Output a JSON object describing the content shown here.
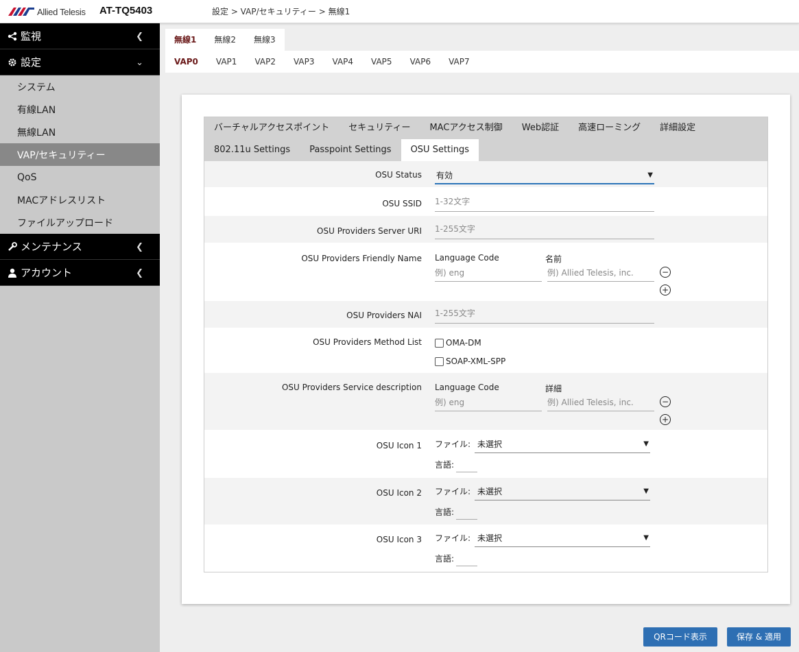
{
  "header": {
    "brand": "Allied Telesis",
    "model": "AT-TQ5403",
    "breadcrumb": "設定 > VAP/セキュリティー > 無線1"
  },
  "sidebar": {
    "sections": [
      {
        "label": "監視",
        "icon": "share-icon"
      },
      {
        "label": "設定",
        "icon": "gear-icon"
      },
      {
        "label": "メンテナンス",
        "icon": "wrench-icon"
      },
      {
        "label": "アカウント",
        "icon": "user-icon"
      }
    ],
    "settings_items": [
      "システム",
      "有線LAN",
      "無線LAN",
      "VAP/セキュリティー",
      "QoS",
      "MACアドレスリスト",
      "ファイルアップロード"
    ]
  },
  "radio_tabs": [
    "無線1",
    "無線2",
    "無線3"
  ],
  "vap_tabs": [
    "VAP0",
    "VAP1",
    "VAP2",
    "VAP3",
    "VAP4",
    "VAP5",
    "VAP6",
    "VAP7"
  ],
  "panel_tabs_row1": [
    "バーチャルアクセスポイント",
    "セキュリティー",
    "MACアクセス制御",
    "Web認証",
    "高速ローミング",
    "詳細設定"
  ],
  "panel_tabs_row2": [
    "802.11u Settings",
    "Passpoint Settings",
    "OSU Settings"
  ],
  "form": {
    "osu_status": {
      "label": "OSU Status",
      "value": "有効"
    },
    "osu_ssid": {
      "label": "OSU SSID",
      "placeholder": "1-32文字"
    },
    "server_uri": {
      "label": "OSU Providers Server URI",
      "placeholder": "1-255文字"
    },
    "friendly_name": {
      "label": "OSU Providers Friendly Name",
      "col1": "Language Code",
      "col2": "名前",
      "ph1": "例) eng",
      "ph2": "例) Allied Telesis, inc."
    },
    "nai": {
      "label": "OSU Providers NAI",
      "placeholder": "1-255文字"
    },
    "method_list": {
      "label": "OSU Providers Method List",
      "opt1": "OMA-DM",
      "opt2": "SOAP-XML-SPP"
    },
    "service_desc": {
      "label": "OSU Providers Service description",
      "col1": "Language Code",
      "col2": "詳細",
      "ph1": "例) eng",
      "ph2": "例) Allied Telesis, inc."
    },
    "icons": [
      {
        "label": "OSU Icon 1",
        "file_label": "ファイル:",
        "file_value": "未選択",
        "lang_label": "言語:"
      },
      {
        "label": "OSU Icon 2",
        "file_label": "ファイル:",
        "file_value": "未選択",
        "lang_label": "言語:"
      },
      {
        "label": "OSU Icon 3",
        "file_label": "ファイル:",
        "file_value": "未選択",
        "lang_label": "言語:"
      }
    ]
  },
  "buttons": {
    "qr": "QRコード表示",
    "save": "保存 & 適用"
  },
  "colors": {
    "accent": "#2e6fb3",
    "active_tab": "#6b1a1a",
    "sidebar_active": "#888888"
  }
}
